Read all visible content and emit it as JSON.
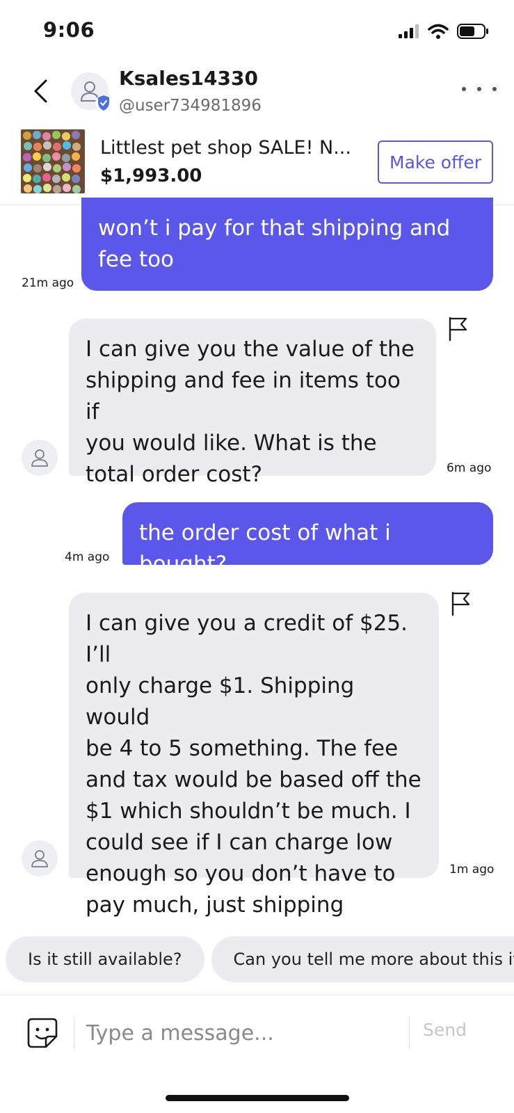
{
  "status_bar": {
    "time": "9:06"
  },
  "header": {
    "back_icon": "chevron-left-icon",
    "seller_name": "Ksales14330",
    "seller_handle": "@user734981896",
    "more_icon": "more-horizontal-icon"
  },
  "listing": {
    "title": "Littlest pet shop SALE! N...",
    "price": "$1,993.00",
    "make_offer_label": "Make offer"
  },
  "messages": [
    {
      "direction": "outgoing",
      "text": "won’t i pay for that shipping and\nfee too",
      "time": "21m ago"
    },
    {
      "direction": "incoming",
      "text": "I can give you the value of the\nshipping and fee in items too if\nyou would like. What is the\ntotal order cost?",
      "time": "6m ago"
    },
    {
      "direction": "outgoing",
      "text": "the order cost of what i bought?",
      "time": "4m ago"
    },
    {
      "direction": "incoming",
      "text": "I can give you a credit of $25. I’ll\nonly charge $1. Shipping would\nbe 4 to 5 something. The fee\nand tax would be based off the\n$1 which shouldn’t be much. I\ncould see if I can charge low\nenough so you don’t have to\npay much, just shipping",
      "time": "1m ago"
    }
  ],
  "quick_replies": [
    "Is it still available?",
    "Can you tell me more about this item?"
  ],
  "composer": {
    "placeholder": "Type a message...",
    "send_label": "Send"
  },
  "colors": {
    "accent": "#5b57eb",
    "incoming_bubble": "#ebebf0",
    "send_disabled": "#c5c5cc"
  }
}
